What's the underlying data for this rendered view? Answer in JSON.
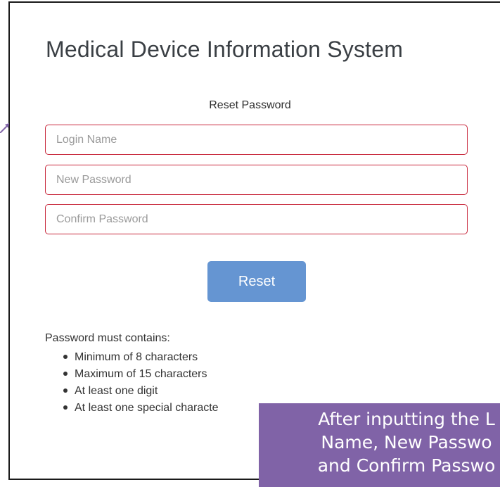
{
  "page": {
    "title": "Medical Device Information System",
    "subtitle": "Reset Password"
  },
  "form": {
    "login_name": {
      "placeholder": "Login Name",
      "value": ""
    },
    "new_password": {
      "placeholder": "New Password",
      "value": ""
    },
    "confirm_password": {
      "placeholder": "Confirm Password",
      "value": ""
    },
    "reset_label": "Reset"
  },
  "rules": {
    "heading": "Password must contains:",
    "items": [
      "Minimum of 8 characters",
      "Maximum of 15 characters",
      "At least one digit",
      "At least one special characte"
    ]
  },
  "callout": {
    "lines": [
      "After inputting the L",
      "Name, New Passwo",
      "and Confirm Passwo"
    ]
  },
  "colors": {
    "button": "#6595d2",
    "field_border": "#c8283c",
    "callout_bg": "#8063a7",
    "arrow": "#8063a7"
  }
}
